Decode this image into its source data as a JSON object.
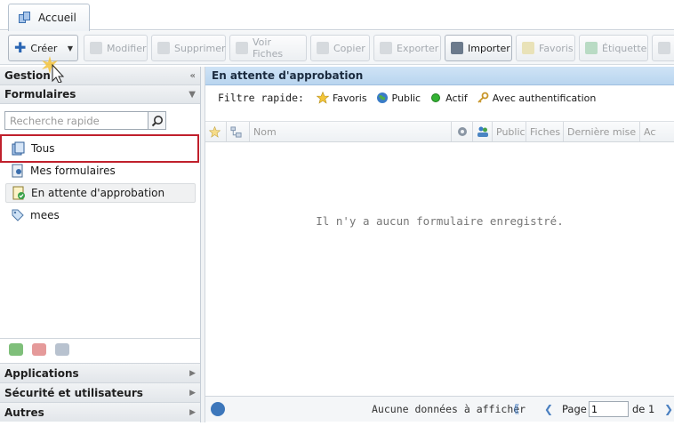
{
  "tabs": [
    {
      "label": "Accueil"
    }
  ],
  "toolbar": {
    "create": "Créer",
    "modify": "Modifier",
    "delete": "Supprimer",
    "view_forms": "Voir Fiches",
    "copy": "Copier",
    "export": "Exporter",
    "import": "Importer",
    "favorites": "Favoris",
    "label": "Étiquette"
  },
  "left": {
    "management_header": "Gestion",
    "forms_header": "Formulaires",
    "search_placeholder": "Recherche rapide",
    "items": [
      {
        "label": "Tous"
      },
      {
        "label": "Mes formulaires"
      },
      {
        "label": "En attente d'approbation"
      },
      {
        "label": "mees"
      }
    ],
    "sections": [
      {
        "label": "Applications"
      },
      {
        "label": "Sécurité et utilisateurs"
      },
      {
        "label": "Autres"
      }
    ]
  },
  "main": {
    "title": "En attente d'approbation",
    "filter_label": "Filtre rapide:",
    "filters": [
      {
        "label": "Favoris"
      },
      {
        "label": "Public"
      },
      {
        "label": "Actif"
      },
      {
        "label": "Avec authentification"
      }
    ],
    "columns": {
      "name": "Nom",
      "public": "Public",
      "records": "Fiches",
      "last_update": "Dernière mise à",
      "active": "Act"
    },
    "empty_message": "Il n'y a aucun formulaire enregistré.",
    "pager": {
      "info": "Aucune données à afficher",
      "page_label": "Page",
      "page_value": "1",
      "of_label": "de 1"
    }
  }
}
